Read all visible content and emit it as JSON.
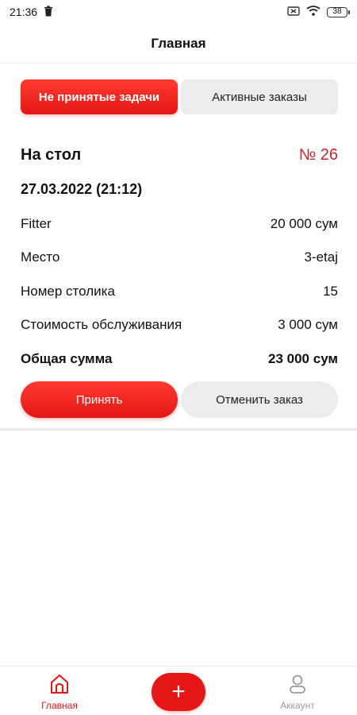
{
  "status_bar": {
    "time": "21:36",
    "battery": "38",
    "icons": [
      "trash-icon",
      "sim-icon",
      "wifi-icon",
      "battery-icon"
    ]
  },
  "app_bar": {
    "title": "Главная"
  },
  "tabs": [
    {
      "label": "Не принятые задачи",
      "active": true
    },
    {
      "label": "Активные заказы",
      "active": false
    }
  ],
  "order": {
    "title": "На стол",
    "number": "№ 26",
    "date": "27.03.2022 (21:12)",
    "rows": [
      {
        "label": "Fitter",
        "value": "20 000 сум"
      },
      {
        "label": "Место",
        "value": "3-etaj"
      },
      {
        "label": "Номер столика",
        "value": "15"
      },
      {
        "label": "Стоимость обслуживания",
        "value": "3 000 сум"
      },
      {
        "label": "Общая сумма",
        "value": "23 000 сум"
      }
    ],
    "accept_label": "Принять",
    "cancel_label": "Отменить заказ"
  },
  "bottom_nav": {
    "home_label": "Главная",
    "fab_label": "+",
    "account_label": "Аккаунт"
  },
  "colors": {
    "accent": "#e41616",
    "order_number": "#c9262e",
    "secondary_button": "#ececec"
  }
}
